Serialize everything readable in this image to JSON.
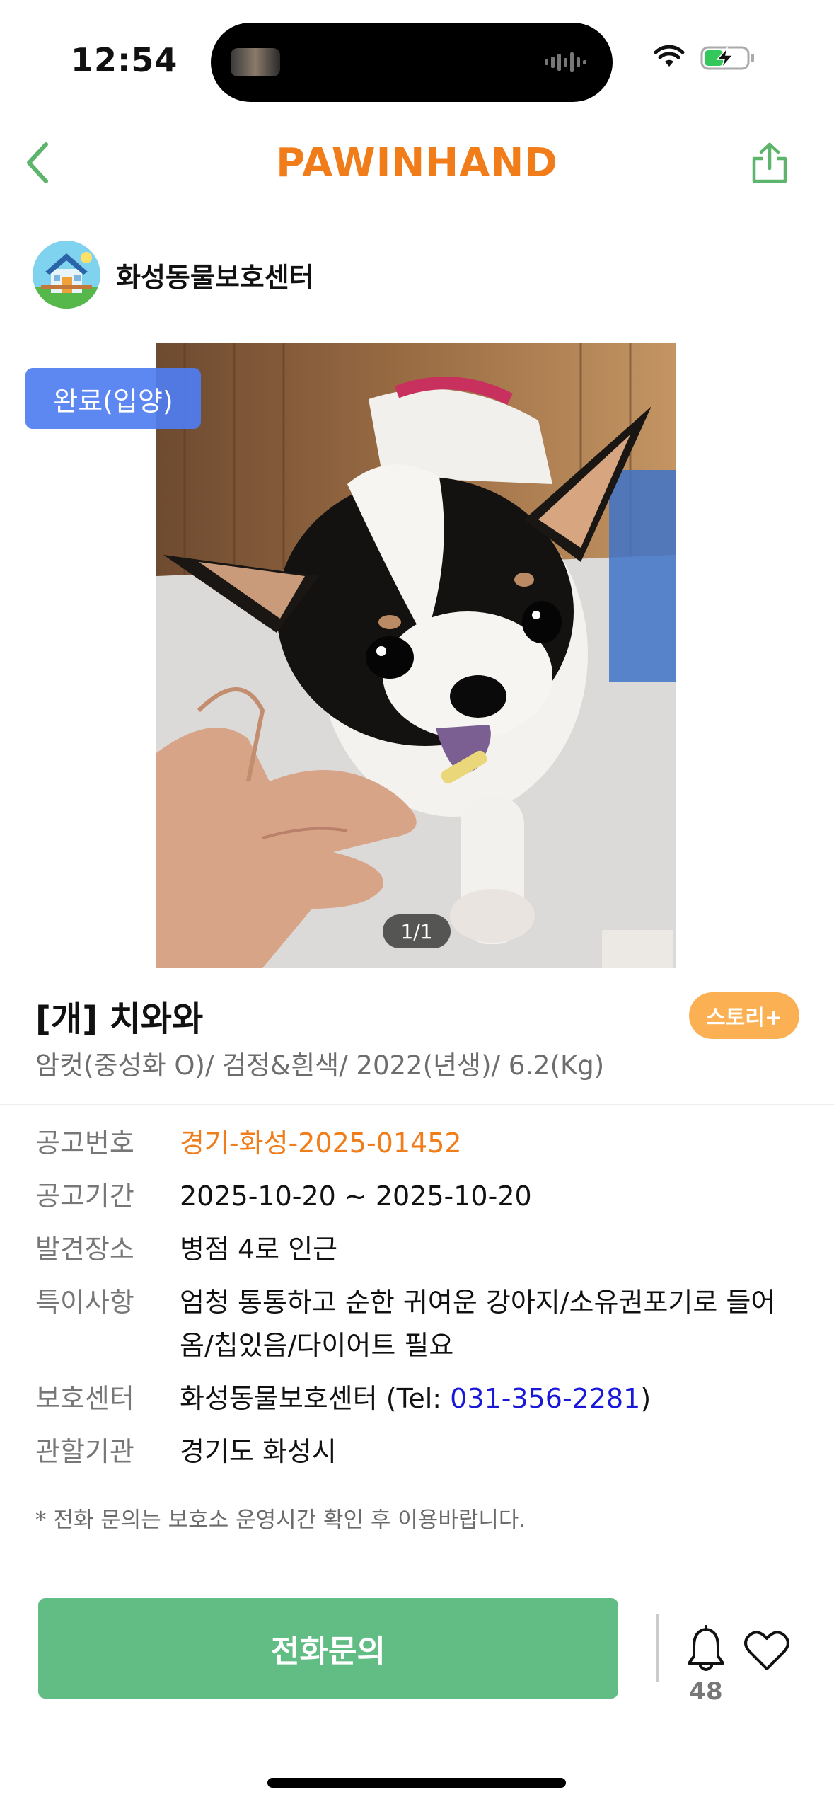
{
  "status_bar": {
    "time": "12:54",
    "battery_state": "charging"
  },
  "header": {
    "logo": "PAWINHAND",
    "brand_color": "#f07c1a",
    "icon_color": "#5cb56a",
    "back_icon": "chevron-left-icon",
    "share_icon": "share-icon"
  },
  "shelter": {
    "name": "화성동물보호센터"
  },
  "photo": {
    "status_badge": "완료(입양)",
    "page_indicator": "1/1"
  },
  "animal": {
    "title": "[개] 치와와",
    "subtitle": "암컷(중성화 O)/ 검정&흰색/ 2022(년생)/ 6.2(Kg)",
    "story_button": "스토리+"
  },
  "info": {
    "notice_no": {
      "label": "공고번호",
      "value": "경기-화성-2025-01452"
    },
    "notice_period": {
      "label": "공고기간",
      "value": "2025-10-20 ~ 2025-10-20"
    },
    "found_place": {
      "label": "발견장소",
      "value": "병점 4로 인근"
    },
    "special": {
      "label": "특이사항",
      "value": "엄청 통통하고 순한 귀여운 강아지/소유권포기로 들어옴/칩있음/다이어트 필요"
    },
    "center": {
      "label": "보호센터",
      "name": "화성동물보호센터",
      "tel_prefix": " (Tel: ",
      "tel": "031-356-2281",
      "tel_suffix": ")"
    },
    "agency": {
      "label": "관할기관",
      "value": "경기도 화성시"
    }
  },
  "note": "* 전화 문의는 보호소 운영시간 확인 후 이용바랍니다.",
  "bottom": {
    "call_button": "전화문의",
    "call_color": "#62bd84",
    "alert_count": "48"
  }
}
